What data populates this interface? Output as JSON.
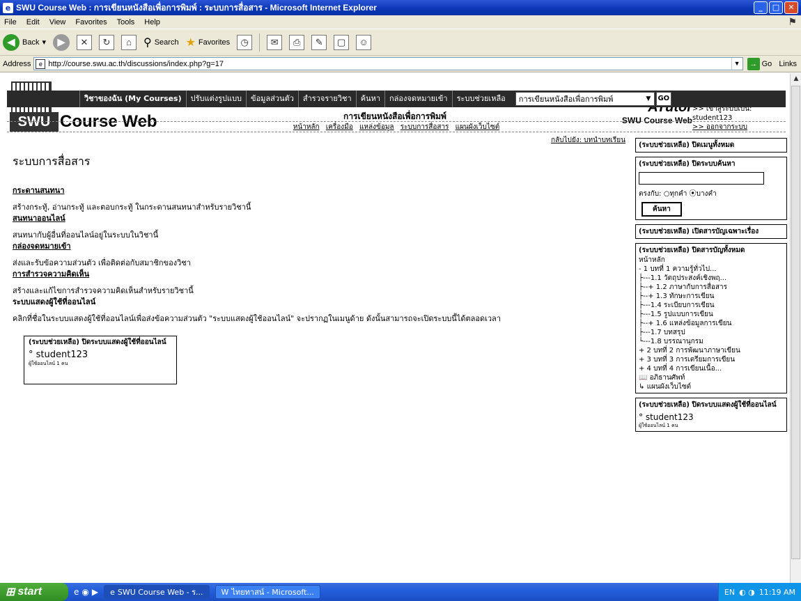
{
  "window": {
    "title": "SWU Course Web : การเขียนหนังสือเพื่อการพิมพ์ : ระบบการสื่อสาร - Microsoft Internet Explorer"
  },
  "menu": [
    "File",
    "Edit",
    "View",
    "Favorites",
    "Tools",
    "Help"
  ],
  "toolbar": {
    "back": "Back",
    "search": "Search",
    "favorites": "Favorites"
  },
  "address": {
    "label": "Address",
    "url": "http://course.swu.ac.th/discussions/index.php?g=17",
    "go": "Go",
    "links": "Links"
  },
  "header": {
    "logo_swu": "SWU",
    "logo_course_web": "Course Web",
    "atutor": "ATutor",
    "swu_course_web": "SWU Course Web",
    "logged_in": ">> เข้าสู่ระบบเป็น: student123",
    "logout": ">> ออกจากระบบ"
  },
  "nav": {
    "items": [
      "วิชาของฉัน (My Courses)",
      "ปรับแต่งรูปแบบ",
      "ข้อมูลส่วนตัว",
      "สำรวจรายวิชา",
      "ค้นหา",
      "กล่องจดหมายเข้า",
      "ระบบช่วยเหลือ"
    ],
    "course_select": "การเขียนหนังสือเพื่อการพิมพ์",
    "go": "GO"
  },
  "course_title": "การเขียนหนังสือเพื่อการพิมพ์",
  "subnav": [
    "หน้าหลัก",
    "เครื่องมือ",
    "แหล่งข้อมูล",
    "ระบบการสื่อสาร",
    "แผนผังเว็บไซต์"
  ],
  "main": {
    "back_link": "กลับไปยัง: บทนำบทเรียน",
    "title": "ระบบการสื่อสาร",
    "sections": [
      {
        "heading": "กระดานสนทนา",
        "text": "สร้างกระทู้, อ่านกระทู้ และตอบกระทู้ ในกระดานสนทนาสำหรับรายวิชานี้"
      },
      {
        "heading": "สนทนาออนไลน์",
        "text": "สนทนากับผู้อื่นที่ออนไลน์อยู่ในระบบในวิชานี้"
      },
      {
        "heading": "กล่องจดหมายเข้า",
        "text": "ส่งและรับข้อความส่วนตัว เพื่อติดต่อกับสมาชิกของวิชา"
      },
      {
        "heading": "การสำรวจความคิดเห็น",
        "text": "สร้างและแก้ไขการสำรวจความคิดเห็นสำหรับรายวิชานี้"
      },
      {
        "heading": "ระบบแสดงผู้ใช้ที่ออนไลน์",
        "text": "คลิกที่ชื่อในระบบแสดงผู้ใช้ที่ออนไลน์เพื่อส่งข้อความส่วนตัว \"ระบบแสดงผู้ใช้ออนไลน์\" จะปรากฏในเมนูด้าย ดังนั้นสามารถจะเปิดระบบนี้ได้ตลอดเวลา"
      }
    ],
    "users_box": {
      "title": "(ระบบช่วยเหลือ) ปิดระบบแสดงผู้ใช้ที่ออนไลน์",
      "user": "student123",
      "note": "ผู้ใช้ออนไลน์ 1 คน"
    }
  },
  "sidebar": {
    "close_menu": "(ระบบช่วยเหลือ) ปิดเมนูทั้งหมด",
    "close_search": "(ระบบช่วยเหลือ) ปิดระบบค้นหา",
    "match_label": "ตรงกับ:",
    "match_all": "ทุกคำ",
    "match_any": "บางคำ",
    "search_button": "ค้นหา",
    "open_related": "(ระบบช่วยเหลือ) เปิดสารบัญเฉพาะเรื่อง",
    "close_toc": "(ระบบช่วยเหลือ) ปิดสารบัญทั้งหมด",
    "toc_home": "หน้าหลัก",
    "toc": [
      "- 1 บทที่ 1 ความรู้ทั่วไป...",
      "├---1.1 วัตถุประสงค์เชิงพฤ...",
      "├--+ 1.2 ภาษากับการสื่อสาร",
      "├--+ 1.3 ทักษะการเขียน",
      "├---1.4 ระเบียบการเขียน",
      "├---1.5 รูปแบบการเขียน",
      "├--+ 1.6 แหล่งข้อมูลการเขียน",
      "├---1.7 บทสรุป",
      "└---1.8 บรรณานุกรม",
      "+ 2 บทที่ 2 การพัฒนาภาษาเขียน",
      "+ 3 บทที่ 3 การเตรียมการเขียน",
      "+ 4 บทที่ 4 การเขียนเนื้อ...",
      "อภิธานศัพท์",
      "แผนผังเว็บไซต์"
    ],
    "users_title": "(ระบบช่วยเหลือ) ปิดระบบแสดงผู้ใช้ที่ออนไลน์",
    "user": "student123",
    "users_note": "ผู้ใช้ออนไลน์ 1 คน"
  },
  "taskbar": {
    "start": "start",
    "tasks": [
      "SWU Course Web - ร...",
      "ไทยทาสน์ - Microsoft..."
    ],
    "lang": "EN",
    "clock": "11:19 AM"
  }
}
